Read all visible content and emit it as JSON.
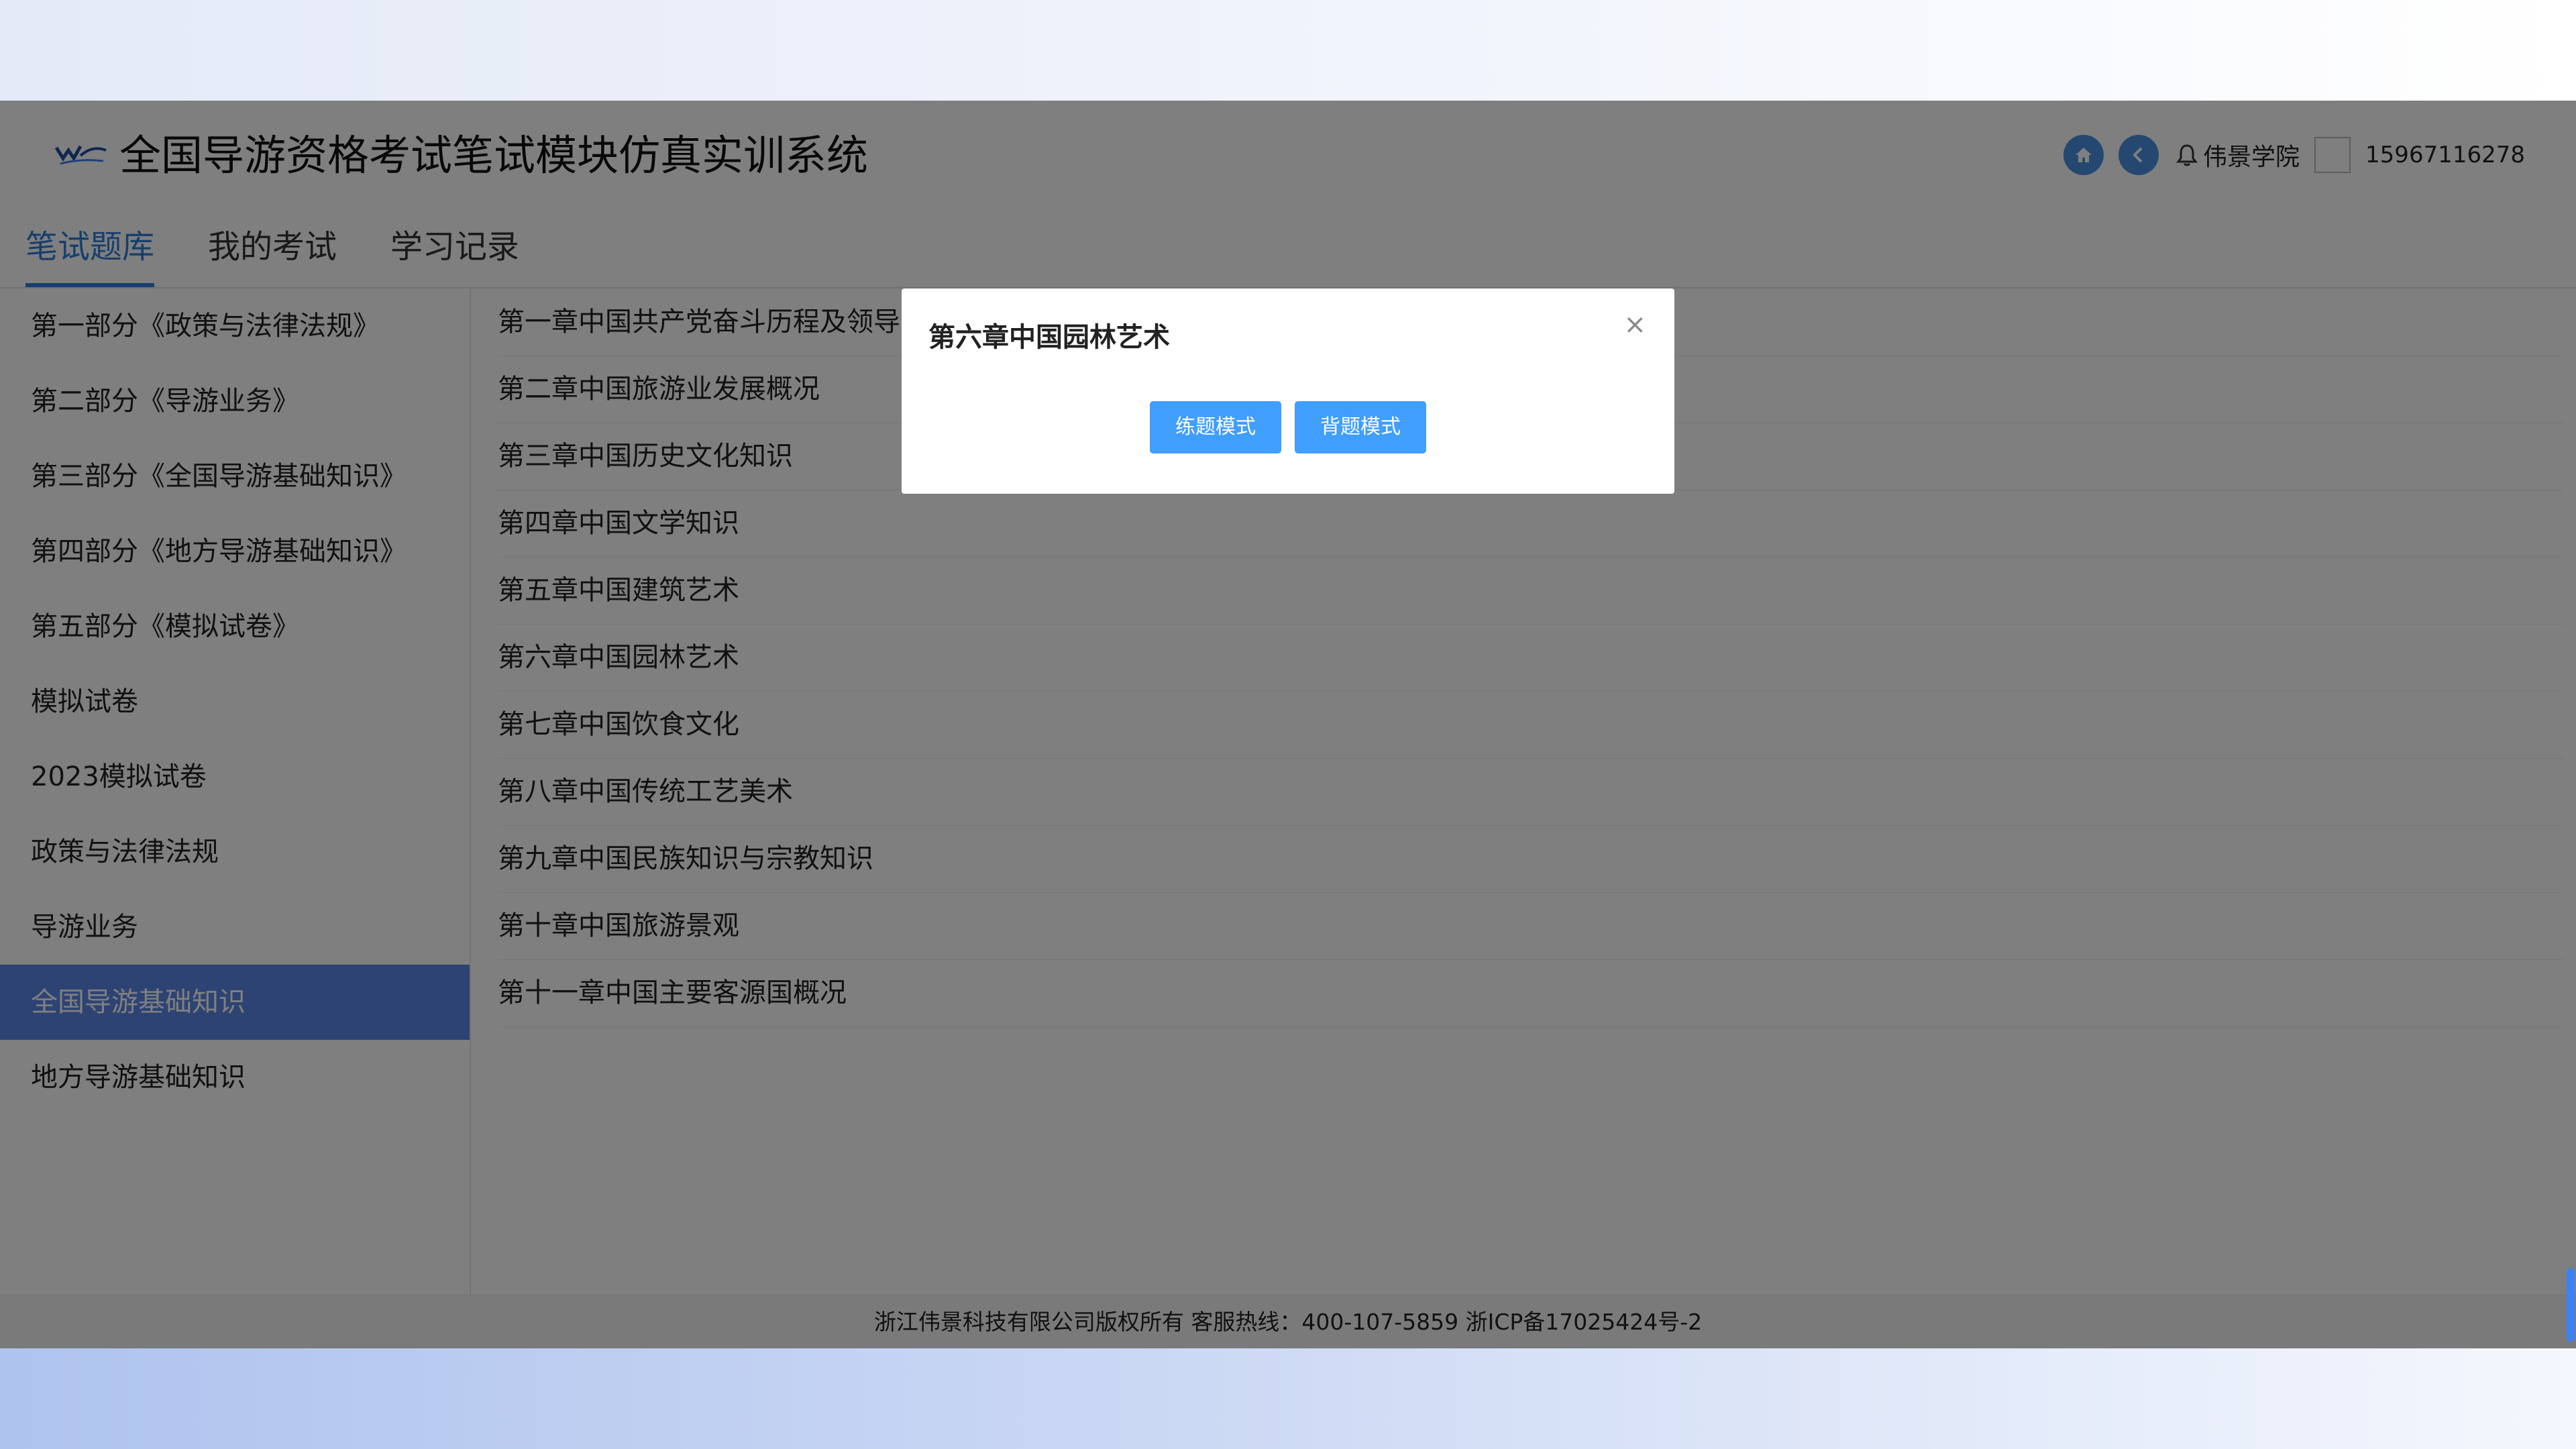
{
  "app": {
    "title": "全国导游资格考试笔试模块仿真实训系统",
    "org_name": "伟景学院",
    "phone": "15967116278"
  },
  "tabs": [
    {
      "label": "笔试题库",
      "active": true
    },
    {
      "label": "我的考试",
      "active": false
    },
    {
      "label": "学习记录",
      "active": false
    }
  ],
  "sidebar": {
    "items": [
      {
        "label": "第一部分《政策与法律法规》"
      },
      {
        "label": "第二部分《导游业务》"
      },
      {
        "label": "第三部分《全国导游基础知识》"
      },
      {
        "label": "第四部分《地方导游基础知识》"
      },
      {
        "label": "第五部分《模拟试卷》"
      },
      {
        "label": "模拟试卷"
      },
      {
        "label": "2023模拟试卷"
      },
      {
        "label": "政策与法律法规"
      },
      {
        "label": "导游业务"
      },
      {
        "label": "全国导游基础知识",
        "active": true
      },
      {
        "label": "地方导游基础知识"
      }
    ]
  },
  "chapters": [
    "第一章中国共产党奋斗历程及领导",
    "第二章中国旅游业发展概况",
    "第三章中国历史文化知识",
    "第四章中国文学知识",
    "第五章中国建筑艺术",
    "第六章中国园林艺术",
    "第七章中国饮食文化",
    "第八章中国传统工艺美术",
    "第九章中国民族知识与宗教知识",
    "第十章中国旅游景观",
    "第十一章中国主要客源国概况"
  ],
  "dialog": {
    "title": "第六章中国园林艺术",
    "close_symbol": "×",
    "practice_button": "练题模式",
    "memorize_button": "背题模式"
  },
  "footer": {
    "text": "浙江伟景科技有限公司版权所有 客服热线：400-107-5859 浙ICP备17025424号-2"
  },
  "icons": {
    "logo": "brand-logo-icon",
    "home": "home-icon",
    "back": "chevron-left-icon",
    "bell": "bell-icon"
  },
  "colors": {
    "accent": "#2f7fd9",
    "sidebar_active": "#5a86e6",
    "button": "#409eff"
  }
}
